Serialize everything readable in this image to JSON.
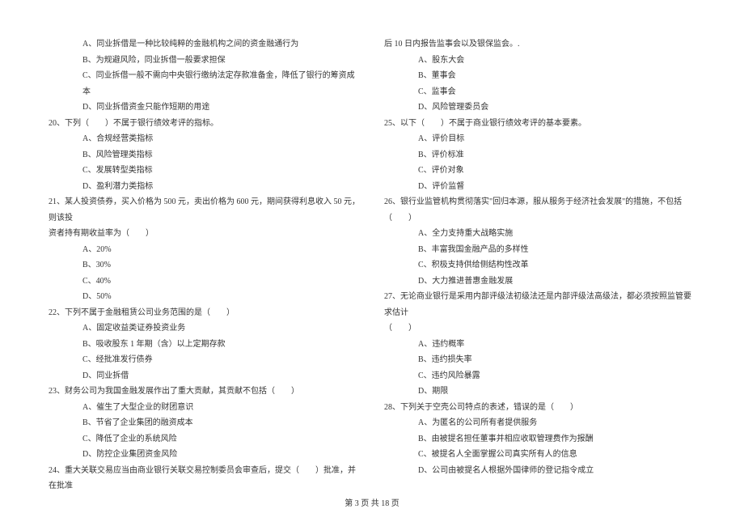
{
  "left": {
    "opts_pre": [
      "A、同业拆借是一种比较纯粹的金融机构之间的资金融通行为",
      "B、为规避风险，同业拆借一般要求担保",
      "C、同业拆借一般不需向中央银行缴纳法定存款准备金，降低了银行的筹资成本",
      "D、同业拆借资金只能作短期的用途"
    ],
    "q20": "20、下列（　　）不属于银行绩效考评的指标。",
    "q20_opts": [
      "A、合规经营类指标",
      "B、风险管理类指标",
      "C、发展转型类指标",
      "D、盈利潜力类指标"
    ],
    "q21": "21、某人投资债券，买入价格为 500 元，卖出价格为 600 元，期间获得利息收入 50 元，则该投",
    "q21_cont": "资者持有期收益率为（　　）",
    "q21_opts": [
      "A、20%",
      "B、30%",
      "C、40%",
      "D、50%"
    ],
    "q22": "22、下列不属于金融租赁公司业务范围的是（　　）",
    "q22_opts": [
      "A、固定收益类证券投资业务",
      "B、吸收股东 1 年期（含）以上定期存款",
      "C、经批准发行债券",
      "D、同业拆借"
    ],
    "q23": "23、财务公司为我国金融发展作出了重大贡献，其贡献不包括（　　）",
    "q23_opts": [
      "A、催生了大型企业的财团意识",
      "B、节省了企业集团的融资成本",
      "C、降低了企业的系统风险",
      "D、防控企业集团资金风险"
    ],
    "q24": "24、重大关联交易应当由商业银行关联交易控制委员会审查后，提交（　　）批准，并在批准"
  },
  "right": {
    "topline": "后 10 日内报告监事会以及银保监会。.",
    "top_opts": [
      "A、股东大会",
      "B、董事会",
      "C、监事会",
      "D、风险管理委员会"
    ],
    "q25": "25、以下（　　）不属于商业银行绩效考评的基本要素。",
    "q25_opts": [
      "A、评价目标",
      "B、评价标准",
      "C、评价对象",
      "D、评价监督"
    ],
    "q26": "26、银行业监管机构贯彻落实\"回归本源，服从服务于经济社会发展\"的措施，不包括（　　）",
    "q26_opts": [
      "A、全力支持重大战略实施",
      "B、丰富我国金融产品的多样性",
      "C、积极支持供给侧结构性改革",
      "D、大力推进普惠金融发展"
    ],
    "q27": "27、无论商业银行是采用内部评级法初级法还是内部评级法高级法，都必须按照监管要求估计",
    "q27_cont": "（　　）",
    "q27_opts": [
      "A、违约概率",
      "B、违约损失率",
      "C、违约风险暴露",
      "D、期限"
    ],
    "q28": "28、下列关于空壳公司特点的表述，错误的是（　　）",
    "q28_opts": [
      "A、为匿名的公司所有者提供服务",
      "B、由被提名担任董事并相应收取管理费作为报酬",
      "C、被提名人全面掌握公司真实所有人的信息",
      "D、公司由被提名人根据外国律师的登记指令成立"
    ]
  },
  "footer": "第 3 页 共 18 页"
}
